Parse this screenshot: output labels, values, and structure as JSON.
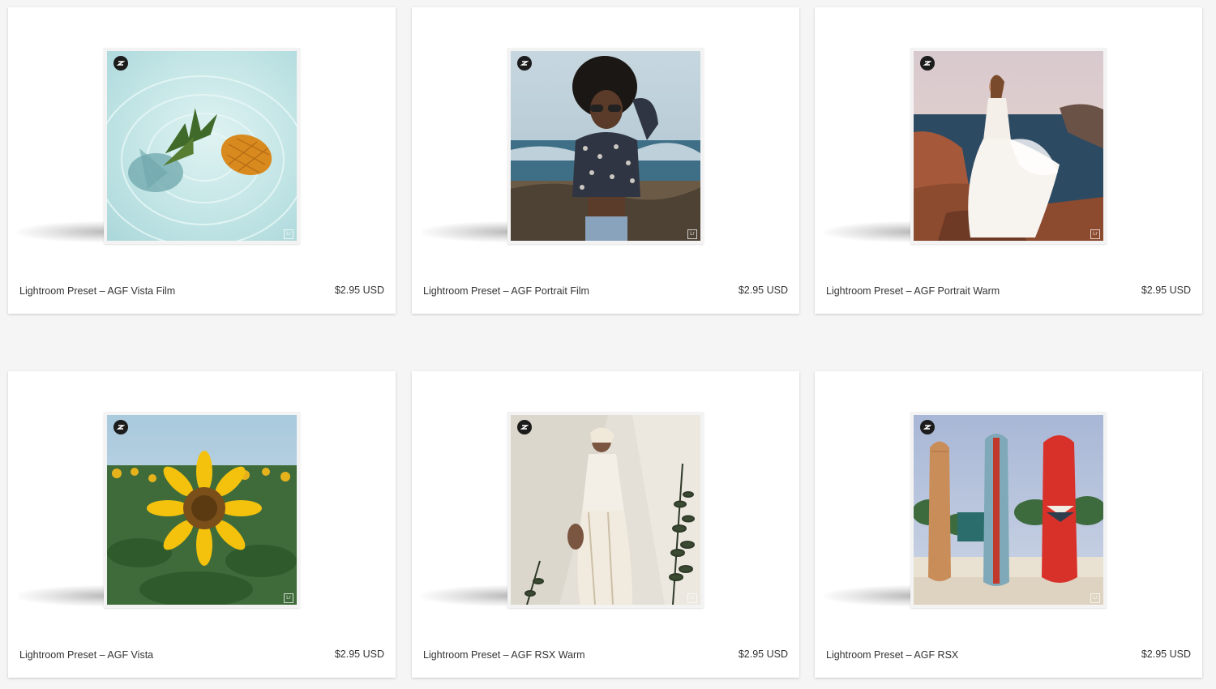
{
  "products": [
    {
      "title": "Lightroom Preset – AGF Vista Film",
      "price": "$2.95 USD",
      "image": "pineapple-in-water",
      "badge_icon": "presetpro-logo-icon",
      "corner_icon": "lightroom-icon",
      "corner_text": "Lr"
    },
    {
      "title": "Lightroom Preset – AGF Portrait Film",
      "price": "$2.95 USD",
      "image": "woman-sunglasses-beach",
      "badge_icon": "presetpro-logo-icon",
      "corner_icon": "lightroom-icon",
      "corner_text": "Lr"
    },
    {
      "title": "Lightroom Preset – AGF Portrait Warm",
      "price": "$2.95 USD",
      "image": "woman-white-dress-coast",
      "badge_icon": "presetpro-logo-icon",
      "corner_icon": "lightroom-icon",
      "corner_text": "Lr"
    },
    {
      "title": "Lightroom Preset – AGF Vista",
      "price": "$2.95 USD",
      "image": "sunflower-field",
      "badge_icon": "presetpro-logo-icon",
      "corner_icon": "lightroom-icon",
      "corner_text": "Lr"
    },
    {
      "title": "Lightroom Preset – AGF RSX Warm",
      "price": "$2.95 USD",
      "image": "woman-boho-dress-wall",
      "badge_icon": "presetpro-logo-icon",
      "corner_icon": "lightroom-icon",
      "corner_text": "Lr"
    },
    {
      "title": "Lightroom Preset – AGF RSX",
      "price": "$2.95 USD",
      "image": "surfboards-on-beach",
      "badge_icon": "presetpro-logo-icon",
      "corner_icon": "lightroom-icon",
      "corner_text": "Lr"
    }
  ],
  "colors": {
    "page_background": "#f5f5f5",
    "card_background": "#ffffff",
    "text": "#333333",
    "badge": "#1c1c1c"
  }
}
